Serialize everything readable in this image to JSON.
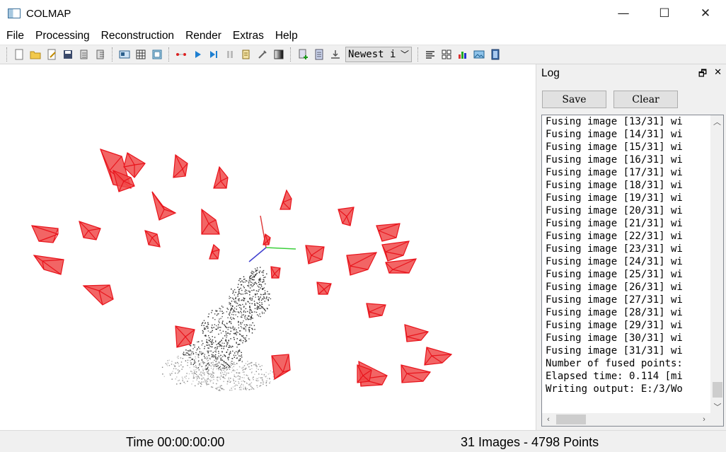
{
  "window": {
    "title": "COLMAP",
    "minimize": "—",
    "maximize": "☐",
    "close": "✕"
  },
  "menu": [
    "File",
    "Processing",
    "Reconstruction",
    "Render",
    "Extras",
    "Help"
  ],
  "toolbar": {
    "groups": [
      [
        "new-project-icon",
        "open-folder-icon",
        "edit-project-icon",
        "save-icon",
        "import-icon",
        "export-icon"
      ],
      [
        "database-management-icon",
        "feature-grid-icon",
        "feature-matching-icon"
      ],
      [
        "connect-nodes-icon",
        "play-icon",
        "step-forward-icon",
        "pause-icon",
        "bundle-adjust-icon",
        "tools-icon",
        "gradient-icon"
      ],
      [
        "add-images-icon",
        "document-icon",
        "download-icon"
      ]
    ],
    "select_value": "Newest i",
    "groups_after": [
      [
        "list-icon",
        "grid-icon",
        "bar-chart-icon",
        "image-icon",
        "film-icon"
      ]
    ]
  },
  "log": {
    "title": "Log",
    "save_label": "Save",
    "clear_label": "Clear",
    "lines": [
      "Fusing image [13/31] wi",
      "Fusing image [14/31] wi",
      "Fusing image [15/31] wi",
      "Fusing image [16/31] wi",
      "Fusing image [17/31] wi",
      "Fusing image [18/31] wi",
      "Fusing image [19/31] wi",
      "Fusing image [20/31] wi",
      "Fusing image [21/31] wi",
      "Fusing image [22/31] wi",
      "Fusing image [23/31] wi",
      "Fusing image [24/31] wi",
      "Fusing image [25/31] wi",
      "Fusing image [26/31] wi",
      "Fusing image [27/31] wi",
      "Fusing image [28/31] wi",
      "Fusing image [29/31] wi",
      "Fusing image [30/31] wi",
      "Fusing image [31/31] wi",
      "Number of fused points:",
      "Elapsed time: 0.114 [mi",
      "Writing output: E:/3/Wo"
    ]
  },
  "status": {
    "time": "Time 00:00:00:00",
    "summary": "31 Images - 4798 Points"
  },
  "colors": {
    "camera": "#e8141c",
    "camera_fill": "#f04a4a",
    "axis_x": "#e04040",
    "axis_y": "#3ccf3c",
    "axis_z": "#4040d0",
    "points": "#2a2a2a"
  }
}
